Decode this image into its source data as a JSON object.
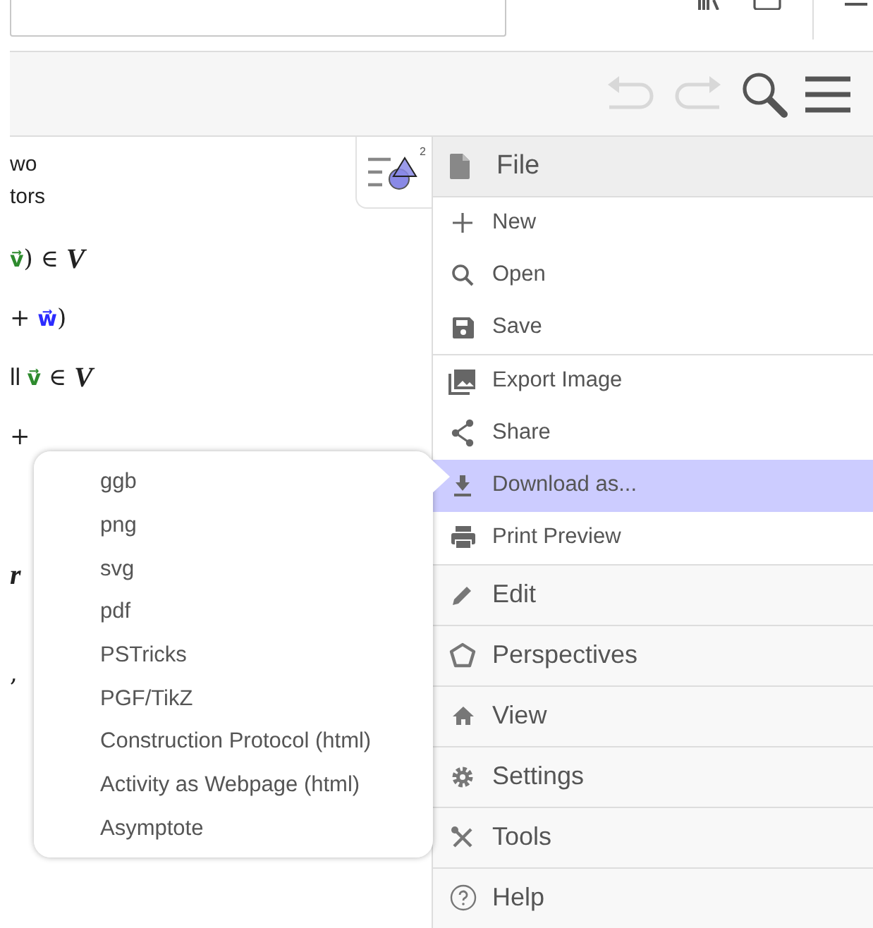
{
  "toolbar": {
    "undo_disabled": true,
    "redo_disabled": true
  },
  "algebra": {
    "style_button_badge": "2",
    "lines": [
      {
        "parts": [
          {
            "kind": "text",
            "text": "wo"
          }
        ]
      },
      {
        "parts": [
          {
            "kind": "text",
            "text": "tors"
          }
        ]
      },
      {
        "parts": [
          {
            "kind": "vector",
            "text": "v⃗",
            "color": "#2e8b2e"
          },
          {
            "kind": "op",
            "text": ") ∈ "
          },
          {
            "kind": "var",
            "text": "V"
          }
        ]
      },
      {
        "parts": [
          {
            "kind": "op",
            "text": "+ "
          },
          {
            "kind": "vector",
            "text": "w⃗",
            "color": "#2b2bff"
          },
          {
            "kind": "op",
            "text": ")"
          }
        ]
      },
      {
        "parts": [
          {
            "kind": "text",
            "text": "ll "
          },
          {
            "kind": "vector",
            "text": "v⃗",
            "color": "#2e8b2e"
          },
          {
            "kind": "op",
            "text": " ∈ "
          },
          {
            "kind": "var",
            "text": "V"
          }
        ]
      },
      {
        "parts": [
          {
            "kind": "op",
            "text": "+"
          }
        ]
      },
      {
        "parts": [
          {
            "kind": "var",
            "text": "r"
          }
        ]
      },
      {
        "parts": [
          {
            "kind": "op",
            "text": ","
          }
        ]
      }
    ]
  },
  "menu": {
    "header": {
      "label": "File"
    },
    "items": [
      {
        "label": "New",
        "selected": false
      },
      {
        "label": "Open",
        "selected": false
      },
      {
        "label": "Save",
        "selected": false
      },
      {
        "label": "Export Image",
        "selected": false
      },
      {
        "label": "Share",
        "selected": false
      },
      {
        "label": "Download as...",
        "selected": true
      },
      {
        "label": "Print Preview",
        "selected": false
      }
    ],
    "sections": [
      {
        "label": "Edit"
      },
      {
        "label": "Perspectives"
      },
      {
        "label": "View"
      },
      {
        "label": "Settings"
      },
      {
        "label": "Tools"
      },
      {
        "label": "Help"
      }
    ]
  },
  "download_submenu": {
    "items": [
      "ggb",
      "png",
      "svg",
      "pdf",
      "PSTricks",
      "PGF/TikZ",
      "Construction Protocol (html)",
      "Activity as Webpage (html)",
      "Asymptote"
    ]
  }
}
